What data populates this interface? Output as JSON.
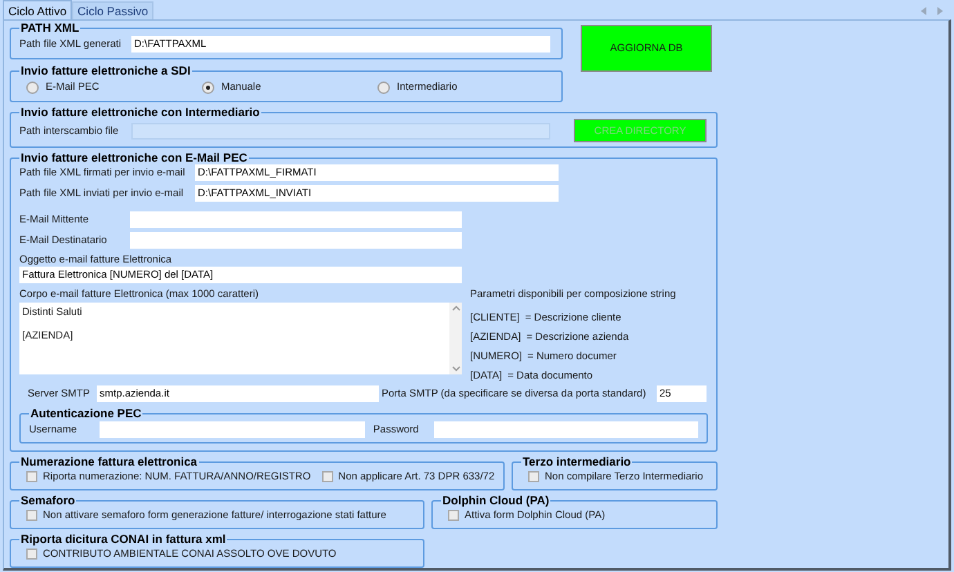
{
  "tabs": [
    {
      "label": "Ciclo Attivo",
      "selected": true
    },
    {
      "label": "Ciclo Passivo",
      "selected": false
    }
  ],
  "path_xml": {
    "title": "PATH  XML",
    "label": "Path file XML generati",
    "value": "D:\\FATTPAXML"
  },
  "update_button": {
    "label": "AGGIORNA DB"
  },
  "sdi": {
    "title": "Invio fatture elettroniche a SDI",
    "options": [
      {
        "label": "E-Mail PEC",
        "selected": false
      },
      {
        "label": "Manuale",
        "selected": true
      },
      {
        "label": "Intermediario",
        "selected": false
      }
    ]
  },
  "intermediary": {
    "title": "Invio fatture elettroniche con Intermediario",
    "label": "Path interscambio file",
    "disabled": true,
    "button": {
      "label": "CREA DIRECTORY",
      "disabled": true
    }
  },
  "pec": {
    "title": "Invio fatture elettroniche con E-Mail PEC",
    "path_fields": [
      {
        "label": "Path file XML firmati per invio e-mail",
        "value": "D:\\FATTPAXML_FIRMATI"
      },
      {
        "label": "Path file XML inviati  per invio e-mail",
        "value": "D:\\FATTPAXML_INVIATI"
      }
    ],
    "mail_fields": [
      {
        "label": "E-Mail Mittente"
      },
      {
        "label": "E-Mail Destinatario"
      }
    ],
    "subject_label": "Oggetto e-mail fatture Elettronica",
    "subject_value": "Fattura Elettronica [NUMERO] del [DATA]",
    "body_label": "Corpo e-mail fatture Elettronica (max 1000 caratteri)",
    "body_lines": [
      "Distinti Saluti",
      "[AZIENDA]"
    ],
    "params_title": "Parametri disponibili per composizione string",
    "params": [
      {
        "code": "[CLIENTE]",
        "description": "= Descrizione cliente"
      },
      {
        "code": "[AZIENDA]",
        "description": "= Descrizione azienda"
      },
      {
        "code": "[NUMERO]",
        "description": "= Numero documer"
      },
      {
        "code": "[DATA]",
        "description": "= Data documento"
      }
    ],
    "smtp_label": "Server SMTP",
    "smtp_value": "smtp.azienda.it",
    "port_label": "Porta SMTP (da specificare se diversa da porta standard)",
    "port_value": "25",
    "auth": {
      "title": "Autenticazione PEC",
      "username_label": "Username",
      "password_label": "Password"
    }
  },
  "numbering": {
    "title": "Numerazione fattura elettronica",
    "options": [
      {
        "label": "Riporta numerazione: NUM. FATTURA/ANNO/REGISTRO",
        "checked": false
      },
      {
        "label": "Non applicare  Art. 73 DPR 633/72",
        "checked": false
      }
    ]
  },
  "third_party": {
    "title": "Terzo intermediario",
    "options": [
      {
        "label": "Non compilare Terzo Intermediario",
        "checked": false
      }
    ]
  },
  "semaphore": {
    "title": "Semaforo",
    "options": [
      {
        "label": "Non attivare semaforo form generazione fatture/ interrogazione stati fatture",
        "checked": false
      }
    ]
  },
  "dolphin": {
    "title": "Dolphin Cloud (PA)",
    "options": [
      {
        "label": "Attiva form Dolphin Cloud (PA)",
        "checked": false
      }
    ]
  },
  "conai": {
    "title": "Riporta dicitura CONAI in fattura xml",
    "options": [
      {
        "label": "CONTRIBUTO AMBIENTALE CONAI ASSOLTO OVE DOVUTO",
        "checked": false
      }
    ]
  }
}
